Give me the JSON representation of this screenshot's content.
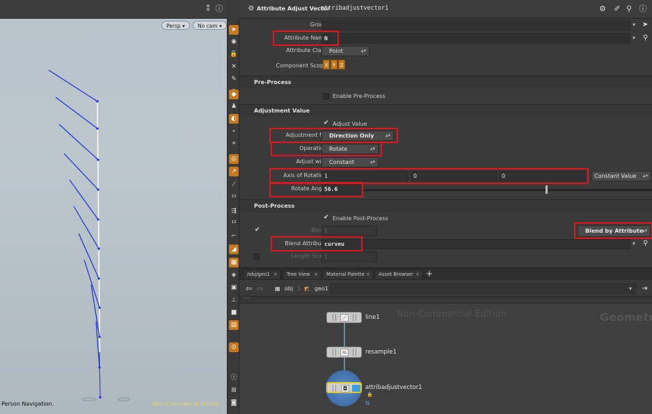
{
  "viewport": {
    "persp_label": "Persp",
    "cam_label": "No cam",
    "status_left": "Person Navigation.",
    "status_right": "Non-Commercial Edition"
  },
  "param_header": {
    "node_type": "Attribute Adjust Vector",
    "node_name": "attribadjustvector1"
  },
  "params": {
    "group_label": "Group",
    "group_value": "",
    "attr_name_label": "Attribute Name",
    "attr_name_value": "N",
    "attr_class_label": "Attribute Class",
    "attr_class_value": "Point",
    "component_scope_label": "Component Scope",
    "components": [
      "X",
      "Y",
      "Z"
    ],
    "preprocess_section": "Pre-Process",
    "enable_preprocess_label": "Enable Pre-Process",
    "adjustment_section": "Adjustment Value",
    "adjust_value_label": "Adjust Value",
    "adjustment_for_label": "Adjustment for",
    "adjustment_for_value": "Direction Only",
    "operation_label": "Operation",
    "operation_value": "Rotate",
    "adjust_with_label": "Adjust with",
    "adjust_with_value": "Constant",
    "axis_label": "Axis of Rotation",
    "axis_values": [
      "1",
      "0",
      "0"
    ],
    "axis_mode_value": "Constant Value",
    "rotate_angle_label": "Rotate Angle",
    "rotate_angle_value": "56.6",
    "rotate_angle_fraction": 0.9,
    "postprocess_section": "Post-Process",
    "enable_postprocess_label": "Enable Post-Process",
    "blend_label": "Blend",
    "blend_value": "1",
    "blend_mode_value": "Blend by Attribute",
    "blend_attr_label": "Blend Attribute",
    "blend_attr_value": "curveu",
    "length_scale_label": "Length Scale",
    "length_scale_value": "1"
  },
  "network": {
    "tabs": [
      "/obj/geo1",
      "Tree View",
      "Material Palette",
      "Asset Browser"
    ],
    "path_obj": "obj",
    "path_geo": "geo1",
    "watermark": "Non-Commercial Edition",
    "context_label": "Geometr",
    "nodes": [
      {
        "name": "line1"
      },
      {
        "name": "resample1"
      },
      {
        "name": "attribadjustvector1",
        "flag": "N"
      }
    ]
  },
  "colors": {
    "accent_orange": "#c47a1c",
    "highlight_red": "#e0161b",
    "viewport_bg": "#b9c3cb",
    "normal_lines": "#1a2fd6"
  }
}
